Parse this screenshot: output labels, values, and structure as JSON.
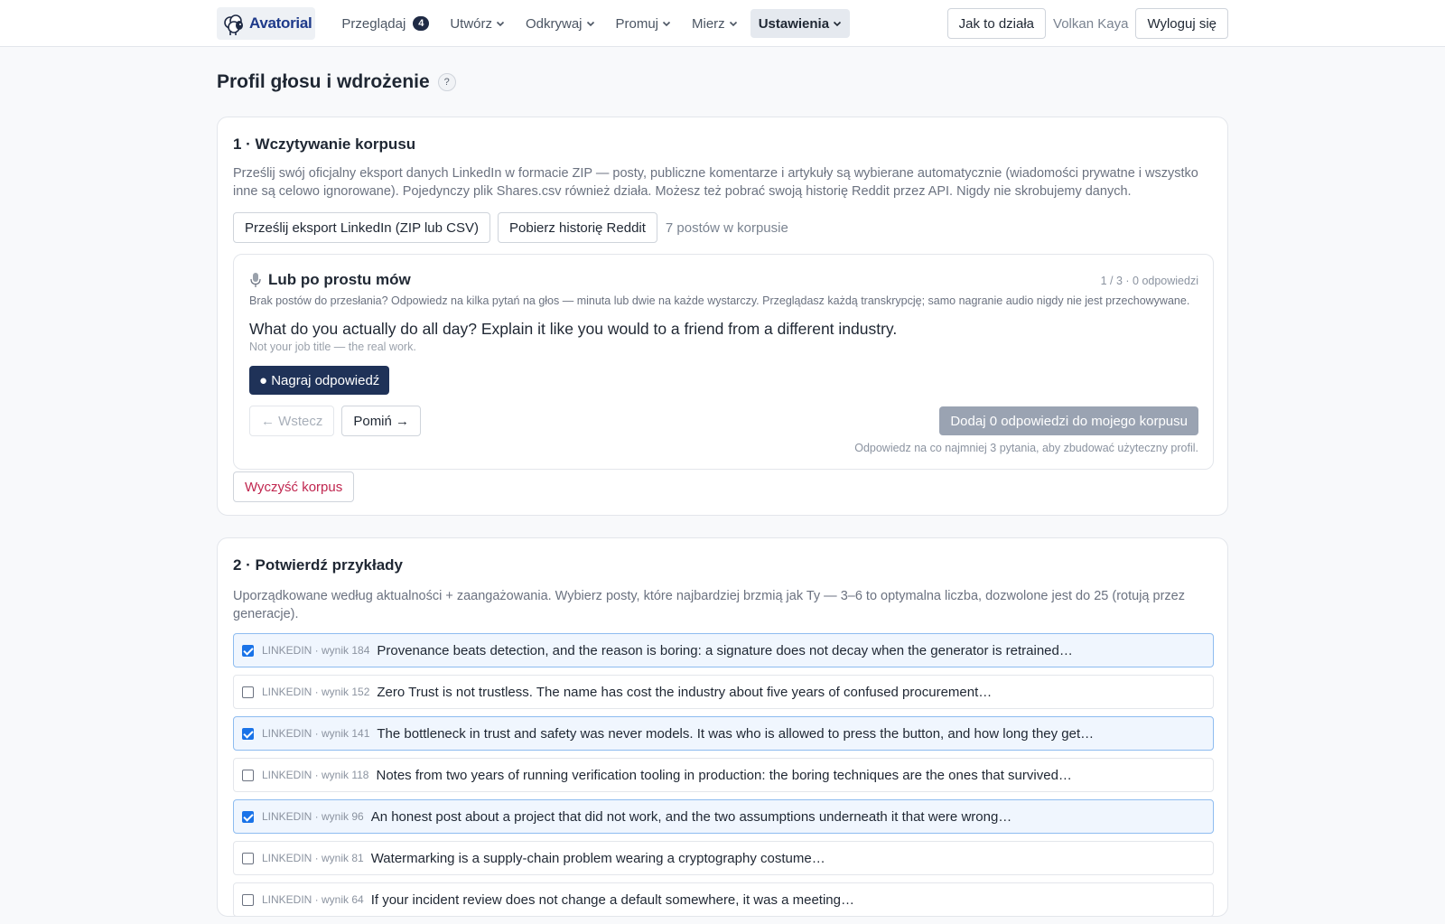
{
  "nav": {
    "logo_text": "Avatorial",
    "items": [
      {
        "label": "Przeglądaj",
        "badge": "4"
      },
      {
        "label": "Utwórz"
      },
      {
        "label": "Odkrywaj"
      },
      {
        "label": "Promuj"
      },
      {
        "label": "Mierz"
      },
      {
        "label": "Ustawienia"
      }
    ],
    "how_it_works": "Jak to działa",
    "user_name": "Volkan Kaya",
    "logout": "Wyloguj się"
  },
  "page": {
    "title": "Profil głosu i wdrożenie",
    "help": "?"
  },
  "section1": {
    "title": "1 · Wczytywanie korpusu",
    "description": "Prześlij swój oficjalny eksport danych LinkedIn w formacie ZIP — posty, publiczne komentarze i artykuły są wybierane automatycznie (wiadomości prywatne i wszystko inne są celowo ignorowane). Pojedynczy plik Shares.csv również działa. Możesz też pobrać swoją historię Reddit przez API. Nigdy nie skrobujemy danych.",
    "upload_button": "Prześlij eksport LinkedIn (ZIP lub CSV)",
    "reddit_button": "Pobierz historię Reddit",
    "corpus_count": "7 postów w korpusie",
    "voice": {
      "title": "Lub po prostu mów",
      "progress": "1 / 3 · 0 odpowiedzi",
      "note": "Brak postów do przesłania? Odpowiedz na kilka pytań na głos — minuta lub dwie na każde wystarczy. Przeglądasz każdą transkrypcję; samo nagranie audio nigdy nie jest przechowywane.",
      "question": "What do you actually do all day? Explain it like you would to a friend from a different industry.",
      "hint": "Not your job title — the real work.",
      "record_button": "● Nagraj odpowiedź",
      "back_button": "← Wstecz",
      "skip_button": "Pomiń →",
      "add_button": "Dodaj 0 odpowiedzi do mojego korpusu",
      "footnote": "Odpowiedz na co najmniej 3 pytania, aby zbudować użyteczny profil."
    },
    "clear_button": "Wyczyść korpus"
  },
  "section2": {
    "title": "2 · Potwierdź przykłady",
    "description": "Uporządkowane według aktualności + zaangażowania. Wybierz posty, które najbardziej brzmią jak Ty — 3–6 to optymalna liczba, dozwolone jest do 25 (rotują przez generacje).",
    "examples": [
      {
        "meta": "LINKEDIN · wynik 184",
        "text": "Provenance beats detection, and the reason is boring: a signature does not decay when the generator is retrained…",
        "checked": true
      },
      {
        "meta": "LINKEDIN · wynik 152",
        "text": "Zero Trust is not trustless. The name has cost the industry about five years of confused procurement…",
        "checked": false
      },
      {
        "meta": "LINKEDIN · wynik 141",
        "text": "The bottleneck in trust and safety was never models. It was who is allowed to press the button, and how long they get…",
        "checked": true
      },
      {
        "meta": "LINKEDIN · wynik 118",
        "text": "Notes from two years of running verification tooling in production: the boring techniques are the ones that survived…",
        "checked": false
      },
      {
        "meta": "LINKEDIN · wynik 96",
        "text": "An honest post about a project that did not work, and the two assumptions underneath it that were wrong…",
        "checked": true
      },
      {
        "meta": "LINKEDIN · wynik 81",
        "text": "Watermarking is a supply-chain problem wearing a cryptography costume…",
        "checked": false
      },
      {
        "meta": "LINKEDIN · wynik 64",
        "text": "If your incident review does not change a default somewhere, it was a meeting…",
        "checked": false
      }
    ]
  },
  "colors": {
    "primary_dark": "#1f3258",
    "danger": "#c0264f",
    "selected_bg": "#f0f6fe",
    "selected_border": "#8ebcf0",
    "checkbox": "#1a73e8"
  }
}
